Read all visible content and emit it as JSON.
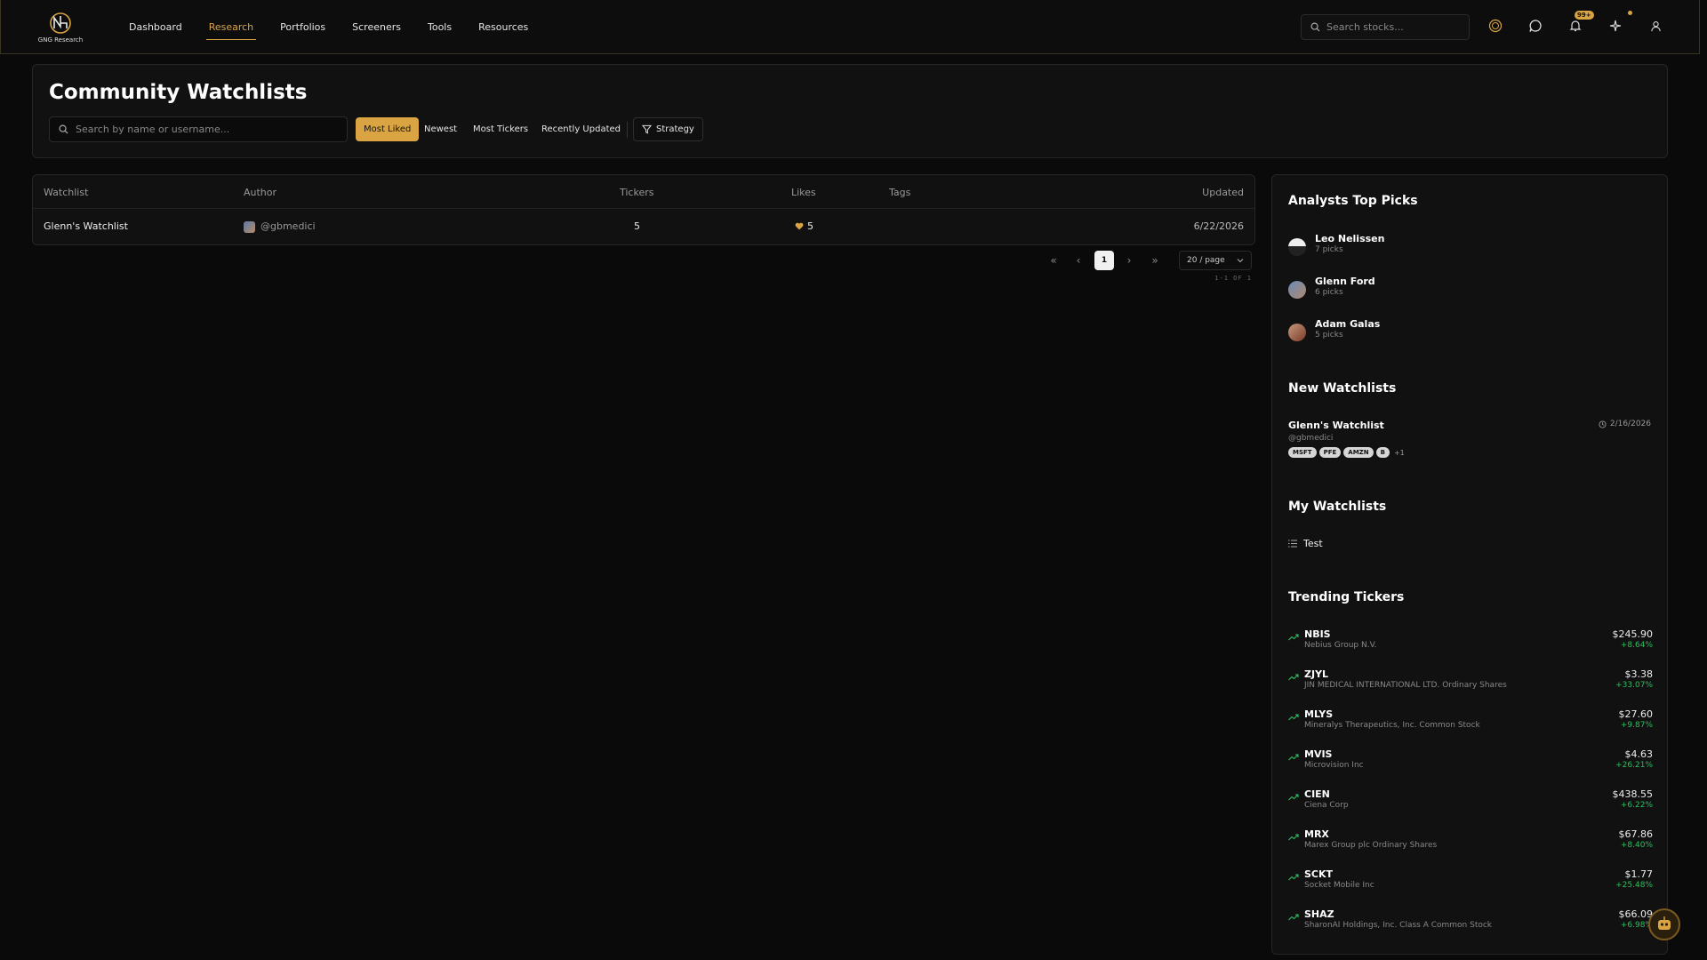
{
  "brand": {
    "name": "GNG Research"
  },
  "nav": {
    "items": [
      {
        "label": "Dashboard",
        "active": false
      },
      {
        "label": "Research",
        "active": true
      },
      {
        "label": "Portfolios",
        "active": false
      },
      {
        "label": "Screeners",
        "active": false
      },
      {
        "label": "Tools",
        "active": false
      },
      {
        "label": "Resources",
        "active": false
      }
    ],
    "search_placeholder": "Search stocks...",
    "notification_badge": "99+"
  },
  "header": {
    "title": "Community Watchlists",
    "search_placeholder": "Search by name or username...",
    "sort_options": [
      {
        "label": "Most Liked",
        "active": true
      },
      {
        "label": "Newest",
        "active": false
      },
      {
        "label": "Most Tickers",
        "active": false
      },
      {
        "label": "Recently Updated",
        "active": false
      }
    ],
    "strategy_label": "Strategy"
  },
  "table": {
    "columns": [
      "Watchlist",
      "Author",
      "Tickers",
      "Likes",
      "Tags",
      "Updated"
    ],
    "rows": [
      {
        "watchlist": "Glenn's Watchlist",
        "author": "@gbmedici",
        "tickers": "5",
        "likes": "5",
        "tags": "",
        "updated": "6/22/2026"
      }
    ]
  },
  "pagination": {
    "current_page": "1",
    "per_page": "20 / page",
    "range": "1-1 OF 1"
  },
  "sidebar": {
    "top_picks": {
      "title": "Analysts Top Picks",
      "items": [
        {
          "name": "Leo Nelissen",
          "picks": "7 picks"
        },
        {
          "name": "Glenn Ford",
          "picks": "6 picks"
        },
        {
          "name": "Adam Galas",
          "picks": "5 picks"
        }
      ]
    },
    "new_watchlists": {
      "title": "New Watchlists",
      "item": {
        "name": "Glenn's Watchlist",
        "user": "@gbmedici",
        "date": "2/16/2026",
        "tags": [
          "MSFT",
          "PFE",
          "AMZN",
          "B"
        ],
        "more": "+1"
      }
    },
    "my_watchlists": {
      "title": "My Watchlists",
      "items": [
        "Test"
      ]
    },
    "trending": {
      "title": "Trending Tickers",
      "accent_up": "#2fbf5f",
      "items": [
        {
          "symbol": "NBIS",
          "name": "Nebius Group N.V.",
          "price": "$245.90",
          "change": "+8.64%"
        },
        {
          "symbol": "ZJYL",
          "name": "JIN MEDICAL INTERNATIONAL LTD. Ordinary Shares",
          "price": "$3.38",
          "change": "+33.07%"
        },
        {
          "symbol": "MLYS",
          "name": "Mineralys Therapeutics, Inc. Common Stock",
          "price": "$27.60",
          "change": "+9.87%"
        },
        {
          "symbol": "MVIS",
          "name": "Microvision Inc",
          "price": "$4.63",
          "change": "+26.21%"
        },
        {
          "symbol": "CIEN",
          "name": "Ciena Corp",
          "price": "$438.55",
          "change": "+6.22%"
        },
        {
          "symbol": "MRX",
          "name": "Marex Group plc Ordinary Shares",
          "price": "$67.86",
          "change": "+8.40%"
        },
        {
          "symbol": "SCKT",
          "name": "Socket Mobile Inc",
          "price": "$1.77",
          "change": "+25.48%"
        },
        {
          "symbol": "SHAZ",
          "name": "SharonAI Holdings, Inc. Class A Common Stock",
          "price": "$66.09",
          "change": "+6.98%"
        }
      ]
    }
  },
  "colors": {
    "accent": "#d9a441",
    "background": "#0a0a0a",
    "panel": "#111111"
  }
}
